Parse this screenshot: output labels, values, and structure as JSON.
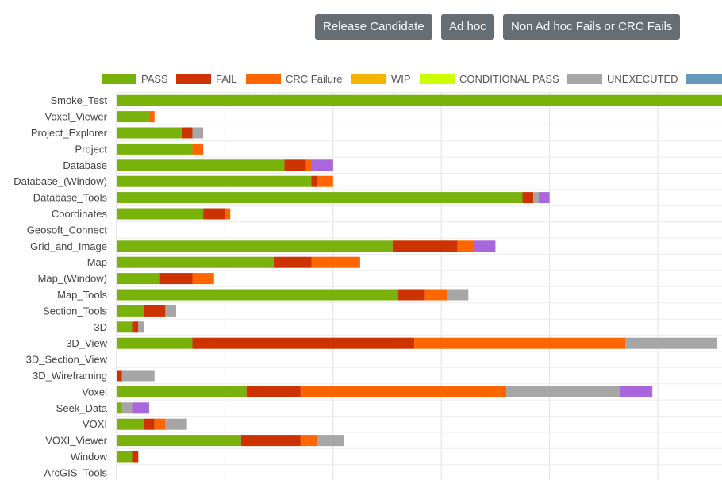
{
  "buttons": {
    "release_candidate": "Release Candidate",
    "ad_hoc": "Ad hoc",
    "non_ad_hoc": "Non Ad hoc Fails or CRC Fails"
  },
  "chart_data": {
    "type": "bar",
    "orientation": "horizontal",
    "stacked": true,
    "title": "",
    "xlabel": "",
    "ylabel": "",
    "grid": true,
    "legend_position": "top",
    "categories": [
      "Smoke_Test",
      "Voxel_Viewer",
      "Project_Explorer",
      "Project",
      "Database",
      "Database_(Window)",
      "Database_Tools",
      "Coordinates",
      "Geosoft_Connect",
      "Grid_and_Image",
      "Map",
      "Map_(Window)",
      "Map_Tools",
      "Section_Tools",
      "3D",
      "3D_View",
      "3D_Section_View",
      "3D_Wireframing",
      "Voxel",
      "Seek_Data",
      "VOXI",
      "VOXI_Viewer",
      "Window",
      "ArcGIS_Tools"
    ],
    "series": [
      {
        "name": "PASS",
        "color": "#78b20a",
        "values": [
          112,
          6,
          12,
          14,
          31,
          36,
          75,
          16,
          0,
          51,
          29,
          8,
          52,
          5,
          3,
          14,
          0,
          0,
          24,
          1,
          5,
          23,
          3,
          0
        ]
      },
      {
        "name": "FAIL",
        "color": "#cc3300",
        "values": [
          0,
          0,
          2,
          0,
          4,
          1,
          2,
          4,
          0,
          12,
          7,
          6,
          5,
          4,
          1,
          41,
          0,
          1,
          10,
          0,
          2,
          11,
          1,
          0
        ]
      },
      {
        "name": "CRC Failure",
        "color": "#ff6600",
        "values": [
          0,
          1,
          0,
          2,
          1,
          3,
          0,
          1,
          0,
          3,
          9,
          4,
          4,
          0,
          0,
          39,
          0,
          0,
          38,
          0,
          2,
          3,
          0,
          0
        ]
      },
      {
        "name": "WIP",
        "color": "#f5b400",
        "values": [
          0,
          0,
          0,
          0,
          0,
          0,
          0,
          0,
          0,
          0,
          0,
          0,
          0,
          0,
          0,
          0,
          0,
          0,
          0,
          0,
          0,
          0,
          0,
          0
        ]
      },
      {
        "name": "CONDITIONAL PASS",
        "color": "#ccff00",
        "values": [
          0,
          0,
          0,
          0,
          0,
          0,
          0,
          0,
          0,
          0,
          0,
          0,
          0,
          0,
          0,
          0,
          0,
          0,
          0,
          0,
          0,
          0,
          0,
          0
        ]
      },
      {
        "name": "UNEXECUTED",
        "color": "#a6a6a6",
        "values": [
          0,
          0,
          2,
          0,
          0,
          0,
          1,
          0,
          0,
          0,
          0,
          0,
          4,
          2,
          1,
          17,
          0,
          6,
          21,
          2,
          4,
          5,
          0,
          0
        ]
      },
      {
        "name": "",
        "color": "#6699bb",
        "values": [
          0,
          0,
          0,
          0,
          4,
          0,
          2,
          0,
          0,
          4,
          0,
          0,
          0,
          0,
          0,
          0,
          0,
          0,
          6,
          3,
          0,
          0,
          0,
          0
        ]
      }
    ],
    "extra_series_colors": [
      "#aa66dd"
    ]
  }
}
